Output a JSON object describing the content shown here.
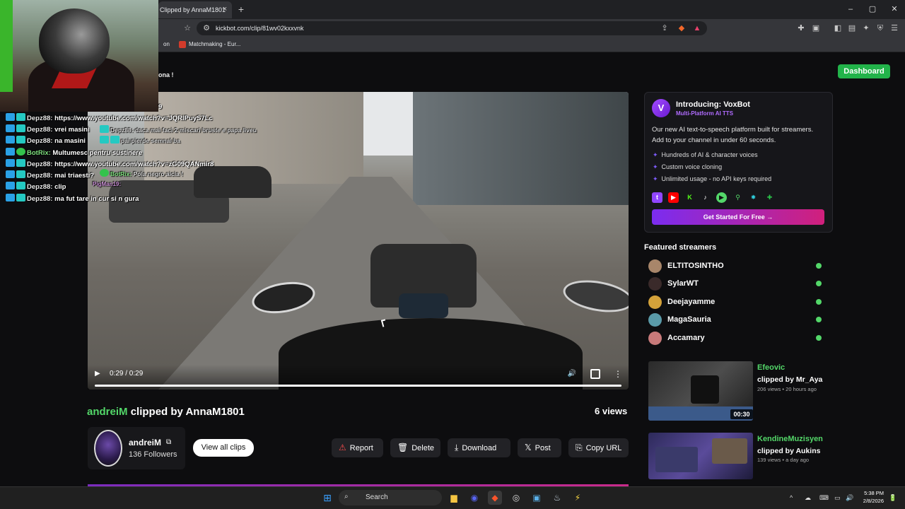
{
  "browser": {
    "tab_title": "Clipped by AnnaM1801",
    "tab_close": "×",
    "new_tab": "+",
    "url": "kickbot.com/clip/81wv02kxxvnk",
    "bookmarks": [
      {
        "label": "on"
      },
      {
        "label": "Matchmaking - Eur..."
      }
    ],
    "window_controls": {
      "minimize": "–",
      "maximize": "▢",
      "close": "✕"
    }
  },
  "chat": [
    {
      "badges": [],
      "user": "",
      "text": "9"
    },
    {
      "badges": [
        "blue",
        "teal"
      ],
      "user": "Depz88:",
      "text": "https://www.youtube.com/watch?v=JQRlPuyS7Lc"
    },
    {
      "badges": [
        "blue",
        "teal"
      ],
      "user": "Depz88:",
      "text": "vrei masini"
    },
    {
      "badges": [
        "blue",
        "teal"
      ],
      "user": "Depz88:",
      "text": "na masini"
    },
    {
      "badges": [
        "blue",
        "green"
      ],
      "user": "BotRix:",
      "text": "Multumesc pentru sustinere"
    },
    {
      "badges": [
        "blue",
        "teal"
      ],
      "user": "Depz88:",
      "text": "https://www.youtube.com/watch?v=zG09QANmir8"
    },
    {
      "badges": [
        "blue",
        "teal"
      ],
      "user": "Depz88:",
      "text": "mai triaesti?"
    },
    {
      "badges": [
        "blue",
        "teal"
      ],
      "user": "Depz88:",
      "text": "clip"
    },
    {
      "badges": [
        "blue",
        "teal"
      ],
      "user": "Depz88:",
      "text": "ma fut tare in cur si n gura"
    }
  ],
  "chat_overlay2": [
    {
      "user": "Depz88:",
      "text": "daca mai faci 2 miscari bruste e papa liveu"
    },
    {
      "user": "",
      "text": "pai pierde semnal ba"
    },
    {
      "user": "BotRix:",
      "text": "Pola negro aicia !"
    },
    {
      "user": "",
      "text": "PigMan19:"
    }
  ],
  "page": {
    "announcement": "ona !",
    "dashboard_label": "Dashboard"
  },
  "video": {
    "play_icon": "▶",
    "time": "0:29 / 0:29",
    "volume_icon": "🔊",
    "more_icon": "⋮",
    "progress": 1.0
  },
  "clip": {
    "streamer": "andreiM",
    "clipped_by": "clipped by AnnaM1801",
    "views": "6 views",
    "channel_name": "andreiM",
    "external_icon": "⧉",
    "followers": "136 Followers",
    "view_all_label": "View all clips",
    "actions": [
      {
        "icon": "⚠",
        "label": "Report"
      },
      {
        "icon": "🗑",
        "label": "Delete"
      },
      {
        "icon": "⤓",
        "label": "Download"
      },
      {
        "icon": "𝕏",
        "label": "Post"
      },
      {
        "icon": "⎘",
        "label": "Copy URL"
      }
    ]
  },
  "promo": {
    "logo_letter": "V",
    "title": "Introducing: VoxBot",
    "subtitle": "Multi-Platform AI TTS",
    "description": "Our new AI text-to-speech platform built for streamers. Add to your channel in under 60 seconds.",
    "features": [
      "Hundreds of AI & character voices",
      "Custom voice cloning",
      "Unlimited usage - no API keys required"
    ],
    "cta": "Get Started For Free →"
  },
  "featured": {
    "title": "Featured streamers",
    "streamers": [
      {
        "name": "ELTITOSINTHO",
        "color": "#a8866a"
      },
      {
        "name": "SylarWT",
        "color": "#3a2a2a"
      },
      {
        "name": "Deejayamme",
        "color": "#d4a23a"
      },
      {
        "name": "MagaSauria",
        "color": "#5a9aa8"
      },
      {
        "name": "Accamary",
        "color": "#c87a7a"
      }
    ]
  },
  "related": [
    {
      "streamer": "Efeovic",
      "by": "clipped by Mr_Aya",
      "meta": "206 views • 20 hours ago",
      "duration": "00:30"
    },
    {
      "streamer": "KendineMuzisyen",
      "by": "clipped by Aukins",
      "meta": "139 views • a day ago",
      "duration": ""
    }
  ],
  "taskbar": {
    "search_label": "Search",
    "search_icon": "⌕",
    "time": "5:38 PM",
    "date": "2/8/2026",
    "tray_icons": [
      "^",
      "☁",
      "⌨",
      "▭",
      "🔊",
      "🔋"
    ]
  },
  "colors": {
    "accent_green": "#53d769",
    "brand_purple": "#7b2cf0",
    "dashboard_green": "#22b34a"
  }
}
